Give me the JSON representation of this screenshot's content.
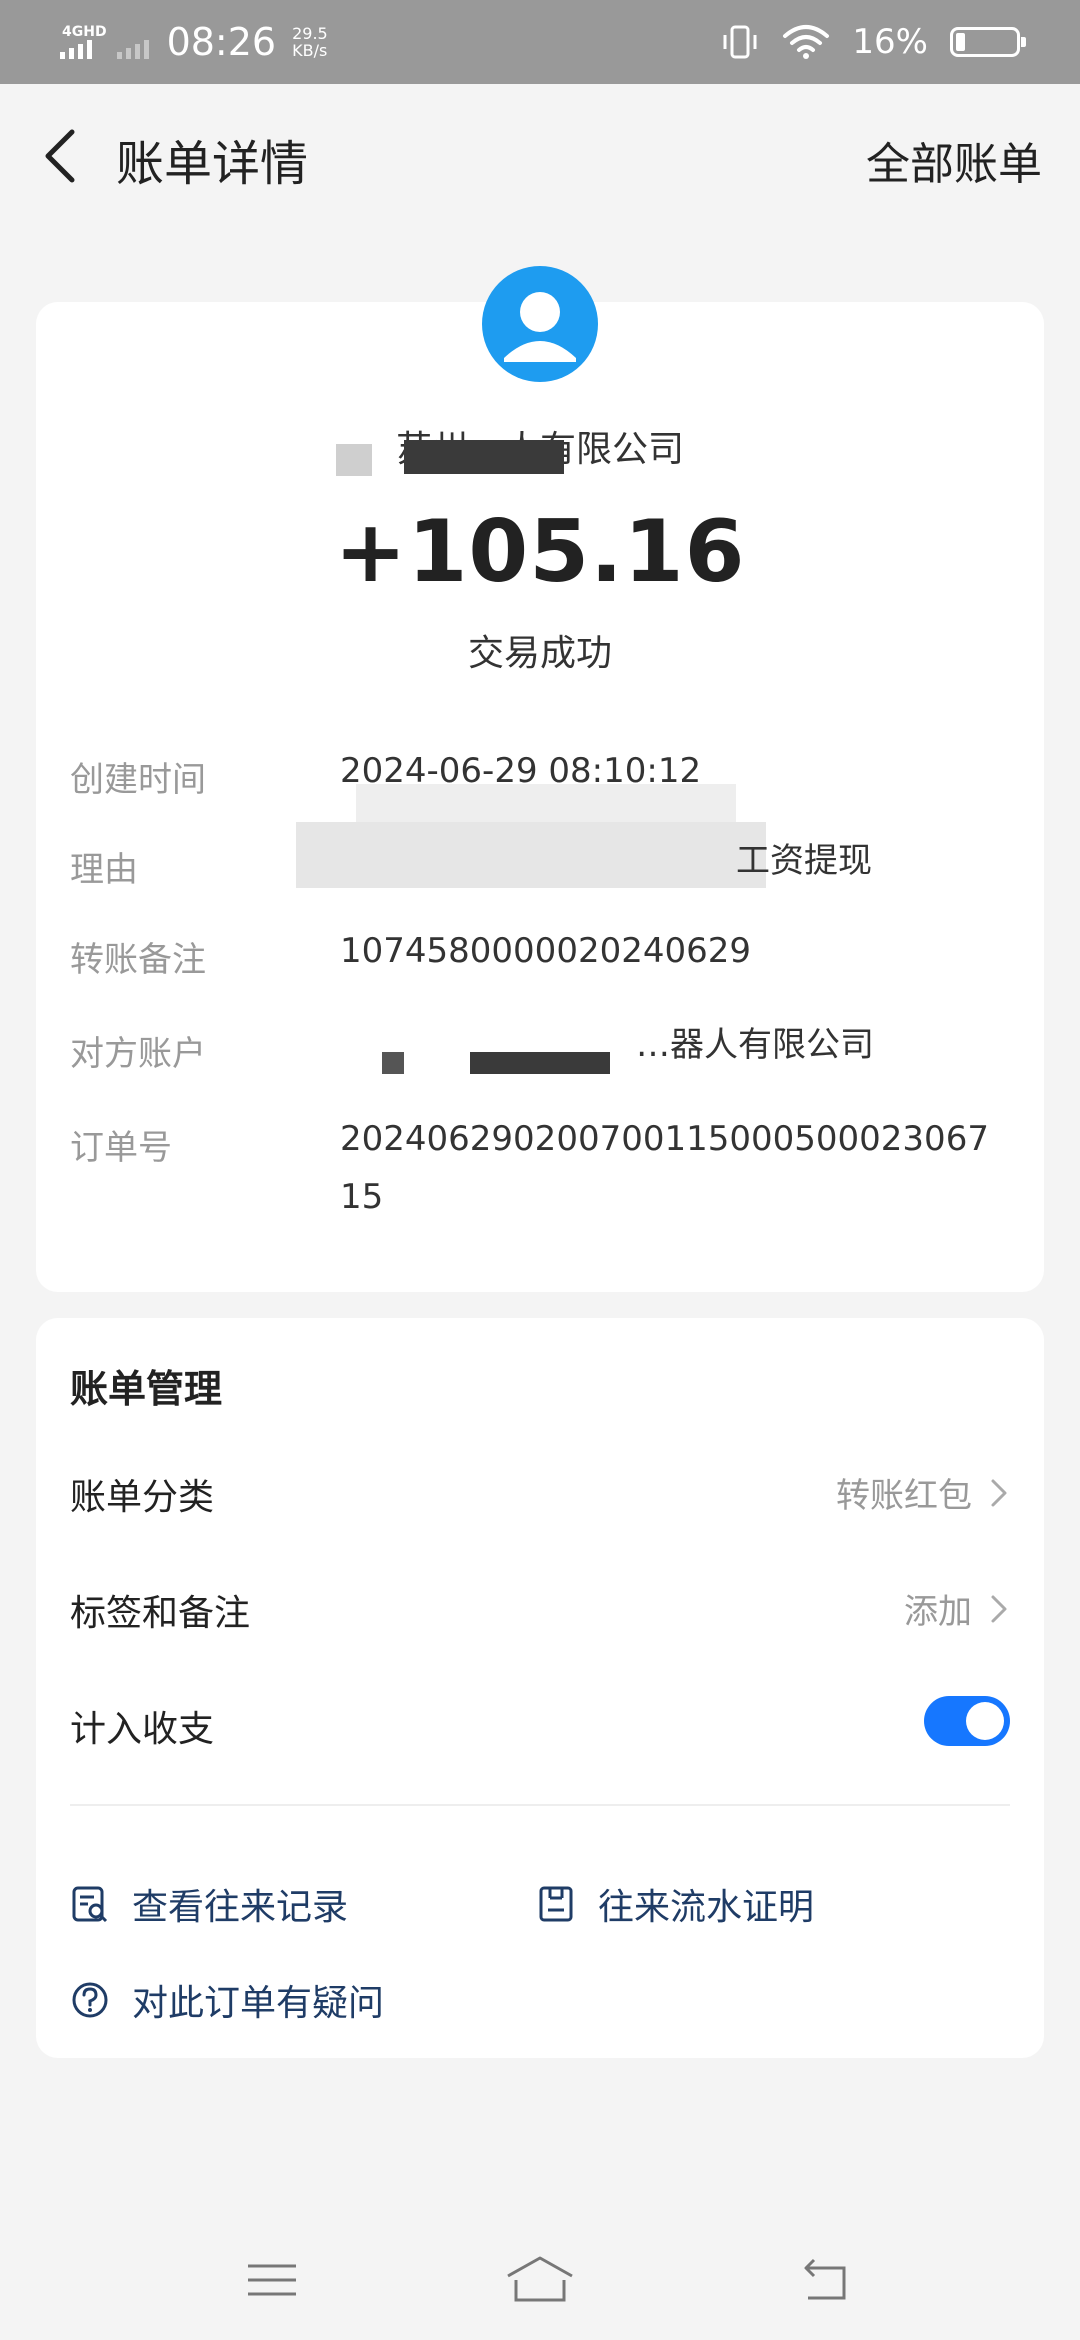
{
  "status_bar": {
    "network": "4GHD",
    "time": "08:26",
    "speed_value": "29.5",
    "speed_unit": "KB/s",
    "battery_percent": "16%",
    "battery_level": 0.16
  },
  "header": {
    "title": "账单详情",
    "right_link": "全部账单"
  },
  "summary": {
    "payee_name": "苏州…人有限公司",
    "amount": "+105.16",
    "status": "交易成功"
  },
  "details": [
    {
      "label": "创建时间",
      "value": "2024-06-29 08:10:12"
    },
    {
      "label": "理由",
      "value": "工资提现"
    },
    {
      "label": "转账备注",
      "value": "1074580000020240629"
    },
    {
      "label": "对方账户",
      "value": "…器人有限公司"
    },
    {
      "label": "订单号",
      "value": "20240629020070011500050002306715"
    }
  ],
  "management": {
    "title": "账单管理",
    "rows": [
      {
        "label": "账单分类",
        "value": "转账红包"
      },
      {
        "label": "标签和备注",
        "value": "添加"
      },
      {
        "label": "计入收支",
        "toggle": true
      }
    ],
    "links": [
      {
        "label": "查看往来记录",
        "icon": "search-record-icon"
      },
      {
        "label": "往来流水证明",
        "icon": "receipt-icon"
      },
      {
        "label": "对此订单有疑问",
        "icon": "question-icon"
      }
    ]
  },
  "colors": {
    "accent": "#1677ff",
    "avatar": "#1e9cf0",
    "link_text": "#1f3c66",
    "status_bar": "#999999"
  }
}
